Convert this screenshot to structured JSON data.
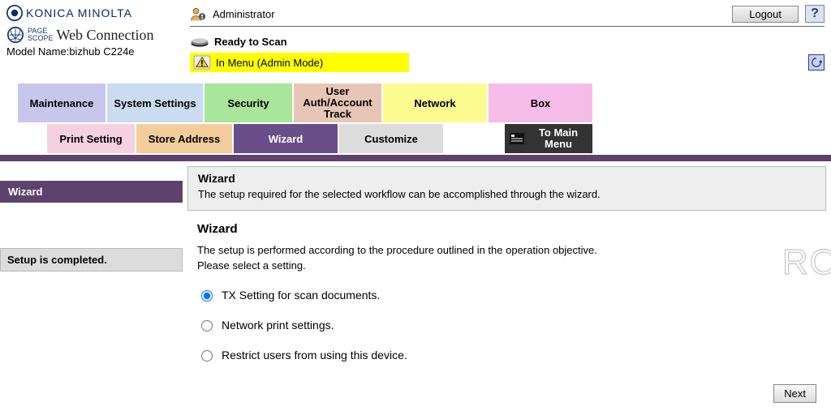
{
  "brand": {
    "company": "KONICA MINOLTA",
    "page_scope_small1": "PAGE",
    "page_scope_small2": "SCOPE",
    "product": "Web Connection",
    "model_label": "Model Name:",
    "model_value": "bizhub C224e"
  },
  "header": {
    "user_role": "Administrator",
    "logout": "Logout",
    "help": "?",
    "status_ready": "Ready to Scan",
    "mode_banner": "In Menu (Admin Mode)"
  },
  "tabs_primary": {
    "maintenance": "Maintenance",
    "system": "System Settings",
    "security": "Security",
    "auth": "User Auth/Account Track",
    "network": "Network",
    "box": "Box"
  },
  "tabs_secondary": {
    "print": "Print Setting",
    "store": "Store Address",
    "wizard": "Wizard",
    "customize": "Customize",
    "to_main": "To Main Menu"
  },
  "sidebar": {
    "active": "Wizard",
    "status": "Setup is completed."
  },
  "panel": {
    "title": "Wizard",
    "desc": "The setup required for the selected workflow can be accomplished through the wizard."
  },
  "section": {
    "title": "Wizard",
    "line1": "The setup is performed according to the procedure outlined in the operation objective.",
    "line2": "Please select a setting."
  },
  "options": {
    "o1": "TX Setting for scan documents.",
    "o2": "Network print settings.",
    "o3": "Restrict users from using this device."
  },
  "buttons": {
    "next": "Next"
  },
  "watermark": "RO"
}
